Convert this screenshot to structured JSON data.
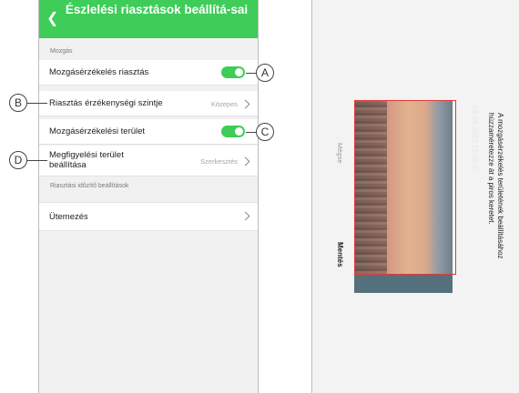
{
  "left_screen": {
    "title": "Észlelési riasztások beállítá-sai",
    "back_icon": "chevron-left-icon",
    "section_motion": "Mozgás",
    "motion_alarm": {
      "label": "Mozgásérzékelés riasztás",
      "toggle_on": true
    },
    "sensitivity": {
      "label": "Riasztás érzékenységi szintje",
      "value": "Közepes"
    },
    "motion_area": {
      "label": "Mozgásérzékelési terület",
      "toggle_on": true
    },
    "observe_area": {
      "label_line1": "Megfigyelési terület",
      "label_line2": "beállítása",
      "value": "Szerkesztés"
    },
    "section_timer": "Riasztási időzítő beállítások",
    "schedule": {
      "label": "Ütemezés"
    },
    "colors": {
      "accent": "#3dcd58"
    }
  },
  "callouts": {
    "a": "A",
    "b": "B",
    "c": "C",
    "d": "D"
  },
  "right_screen": {
    "instruction_line1": "A mozgásérzékelés területének beállításához",
    "instruction_line2": "húzzaméretezze át a piros keretet.",
    "timestamp": "29-09-2021 15:56:3",
    "cancel_label": "Mégse",
    "save_label": "Mentés",
    "frame_color": "#e23a3a"
  }
}
